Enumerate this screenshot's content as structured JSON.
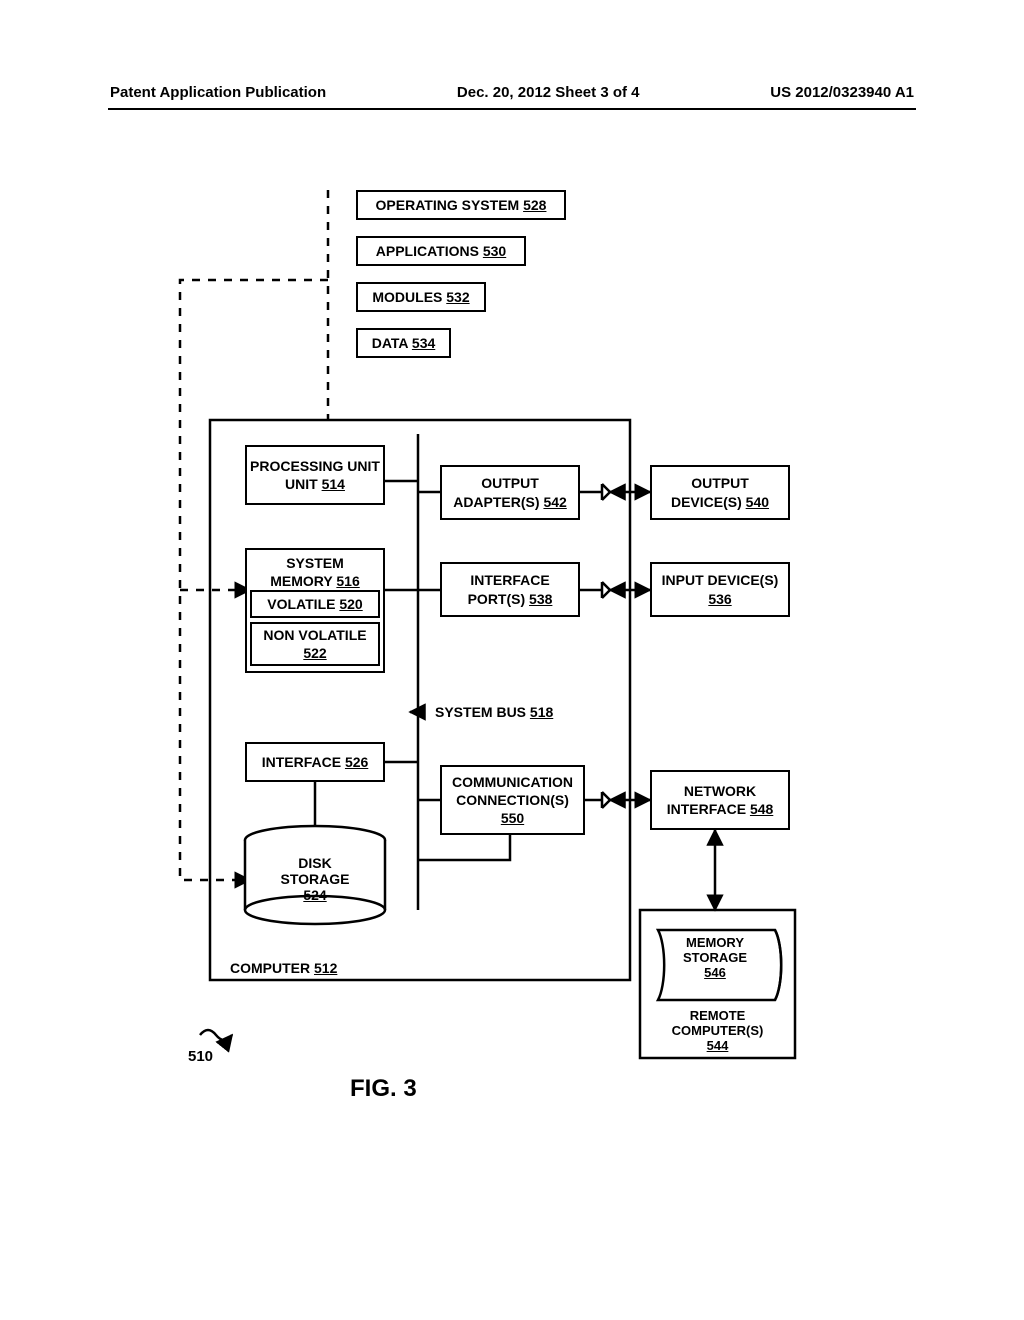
{
  "header": {
    "left": "Patent Application Publication",
    "center": "Dec. 20, 2012  Sheet 3 of 4",
    "right": "US 2012/0323940 A1"
  },
  "boxes": {
    "operating_system": {
      "label": "OPERATING SYSTEM",
      "ref": "528"
    },
    "applications": {
      "label": "APPLICATIONS",
      "ref": "530"
    },
    "modules": {
      "label": "MODULES",
      "ref": "532"
    },
    "data": {
      "label": "DATA",
      "ref": "534"
    },
    "processing_unit": {
      "label": "PROCESSING UNIT",
      "ref": "514"
    },
    "output_adapters": {
      "label": "OUTPUT ADAPTER(S)",
      "ref": "542"
    },
    "output_devices": {
      "label": "OUTPUT DEVICE(S)",
      "ref": "540"
    },
    "system_memory": {
      "label": "SYSTEM MEMORY",
      "ref": "516"
    },
    "volatile": {
      "label": "VOLATILE",
      "ref": "520"
    },
    "non_volatile": {
      "label": "NON VOLATILE",
      "ref": "522"
    },
    "interface_ports": {
      "label": "INTERFACE PORT(S)",
      "ref": "538"
    },
    "input_devices": {
      "label": "INPUT DEVICE(S)",
      "ref": "536"
    },
    "interface": {
      "label": "INTERFACE",
      "ref": "526"
    },
    "comm_conn": {
      "label": "COMMUNICATION CONNECTION(S)",
      "ref": "550"
    },
    "network_interface": {
      "label": "NETWORK INTERFACE",
      "ref": "548"
    },
    "disk_storage": {
      "label": "DISK STORAGE",
      "ref": "524"
    },
    "memory_storage": {
      "label": "MEMORY STORAGE",
      "ref": "546"
    },
    "remote_computers": {
      "label": "REMOTE COMPUTER(S)",
      "ref": "544"
    }
  },
  "labels": {
    "computer": {
      "label": "COMPUTER",
      "ref": "512"
    },
    "system_bus": {
      "label": "SYSTEM BUS",
      "ref": "518"
    }
  },
  "figure_caption": "FIG. 3",
  "ref_510": "510"
}
